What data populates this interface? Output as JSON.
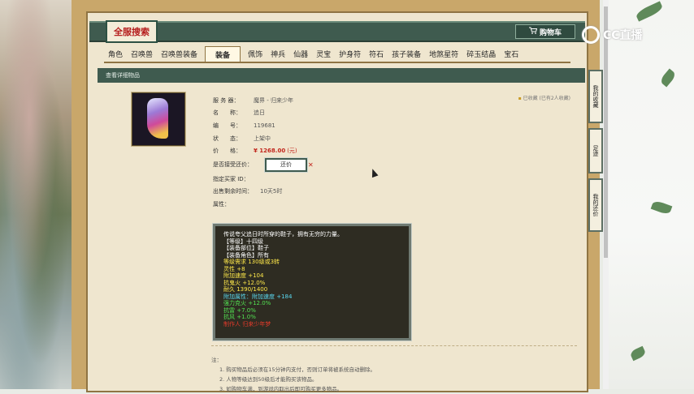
{
  "header": {
    "logo_text": "全服搜索",
    "cart_label": "购物车",
    "cart_icon": "cart-icon"
  },
  "tabs": [
    {
      "label": "角色",
      "active": false
    },
    {
      "label": "召唤兽",
      "active": false
    },
    {
      "label": "召唤兽装备",
      "active": false
    },
    {
      "label": "装备",
      "active": true
    },
    {
      "label": "佩饰",
      "active": false
    },
    {
      "label": "神兵",
      "active": false
    },
    {
      "label": "仙器",
      "active": false
    },
    {
      "label": "灵宝",
      "active": false
    },
    {
      "label": "护身符",
      "active": false
    },
    {
      "label": "符石",
      "active": false
    },
    {
      "label": "孩子装备",
      "active": false
    },
    {
      "label": "地煞星符",
      "active": false
    },
    {
      "label": "碎玉结晶",
      "active": false
    },
    {
      "label": "宝石",
      "active": false
    }
  ],
  "section_title": "查看详细物品",
  "favorite": {
    "label": "已收藏",
    "count_text": "(已有2人收藏)"
  },
  "item": {
    "server_label": "服 务 器：",
    "server_value": "魔界 - 归来少年",
    "name_label": "名　　称：",
    "name_value": "追日",
    "id_label": "编　　号：",
    "id_value": "119681",
    "status_label": "状　　态：",
    "status_value": "上架中",
    "price_label": "价　　格：",
    "price_value": "¥ 1268.00",
    "price_unit": "(元)",
    "counter_label": "是否接受还价：",
    "counter_button": "还价",
    "buyer_label": "指定买家 ID：",
    "buyer_value": "",
    "time_label": "出售剩余时间：",
    "time_value": "10天5时",
    "attr_label": "属性："
  },
  "tooltip": {
    "lines": [
      {
        "text": "传说夸父追日时所穿的鞋子，拥有无穷的力量。",
        "color": "white"
      },
      {
        "text": "【等级】十四级",
        "color": "white"
      },
      {
        "text": "【装备部位】鞋子",
        "color": "white"
      },
      {
        "text": "【装备角色】所有",
        "color": "white"
      },
      {
        "text": "等级需求 130级或3转",
        "color": "yellow"
      },
      {
        "text": "灵性 +8",
        "color": "yellow"
      },
      {
        "text": "附加速度 +104",
        "color": "yellow"
      },
      {
        "text": "抗鬼火 +12.0%",
        "color": "yellow"
      },
      {
        "text": "耐久 1390/1400",
        "color": "yellow"
      },
      {
        "text": "附加属性：附加速度 +184",
        "color": "cyan"
      },
      {
        "text": "强力克火 +12.0%",
        "color": "green"
      },
      {
        "text": "抗雷 +7.0%",
        "color": "green"
      },
      {
        "text": "抗风 +1.0%",
        "color": "green"
      },
      {
        "text": "制作人 归来少年梦",
        "color": "red"
      }
    ]
  },
  "notes": {
    "title": "注：",
    "items": [
      "1. 购买物品后必须在15分钟内支付，否则订单将被系统自动删除。",
      "2. 人物等级达到50级后才能购买该物品。",
      "3. 如购物车满，到游戏内取出后即可购买更多物品。"
    ]
  },
  "side_tabs": [
    {
      "label": "我的收藏"
    },
    {
      "label": "足迹"
    },
    {
      "label": "我的还价"
    }
  ],
  "watermark": "CC直播",
  "colors": {
    "accent_green": "#3f5b4f",
    "panel_bg": "#efe6cf",
    "price_red": "#c2261d"
  }
}
